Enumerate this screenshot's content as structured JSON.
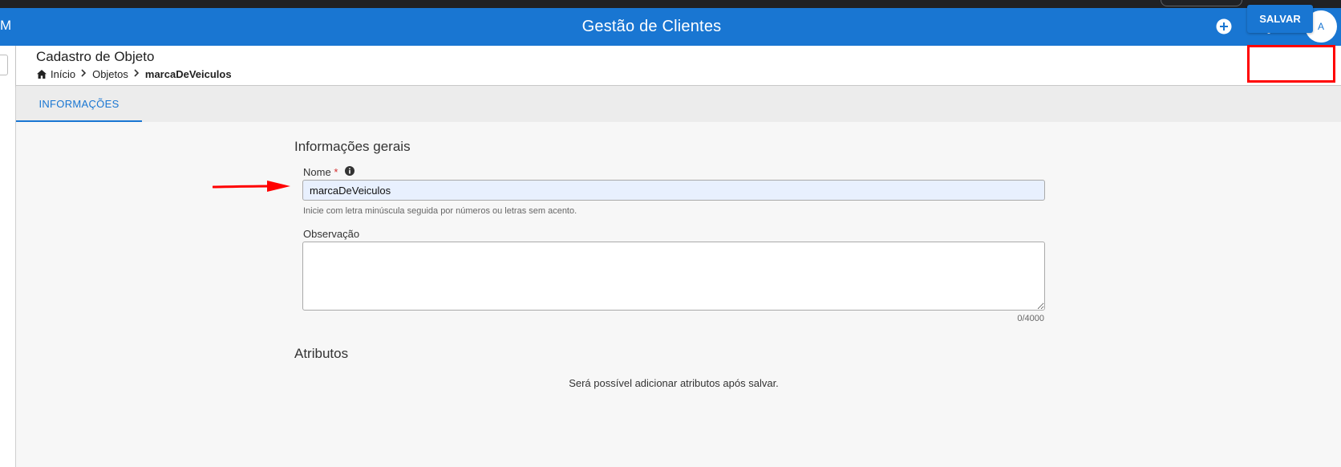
{
  "app": {
    "title": "Gestão de Clientes",
    "left_fragment": "M",
    "avatar_initial": "A",
    "accent": "#1976d2"
  },
  "header": {
    "page_title": "Cadastro de Objeto",
    "breadcrumb": [
      {
        "label": "Início",
        "icon": "home-icon"
      },
      {
        "label": "Objetos"
      },
      {
        "label": "marcaDeVeiculos"
      }
    ],
    "save_label": "SALVAR"
  },
  "tabs": [
    {
      "label": "INFORMAÇÕES",
      "active": true
    }
  ],
  "form": {
    "section_general": "Informações gerais",
    "name_label": "Nome",
    "required_mark": "*",
    "name_value": "marcaDeVeiculos",
    "name_hint": "Inicie com letra minúscula seguida por números ou letras sem acento.",
    "obs_label": "Observação",
    "obs_value": "",
    "obs_counter": "0/4000"
  },
  "attributes": {
    "section_title": "Atributos",
    "empty_message": "Será possível adicionar atributos após salvar."
  },
  "annotations": {
    "highlight_color": "#ff0000"
  }
}
